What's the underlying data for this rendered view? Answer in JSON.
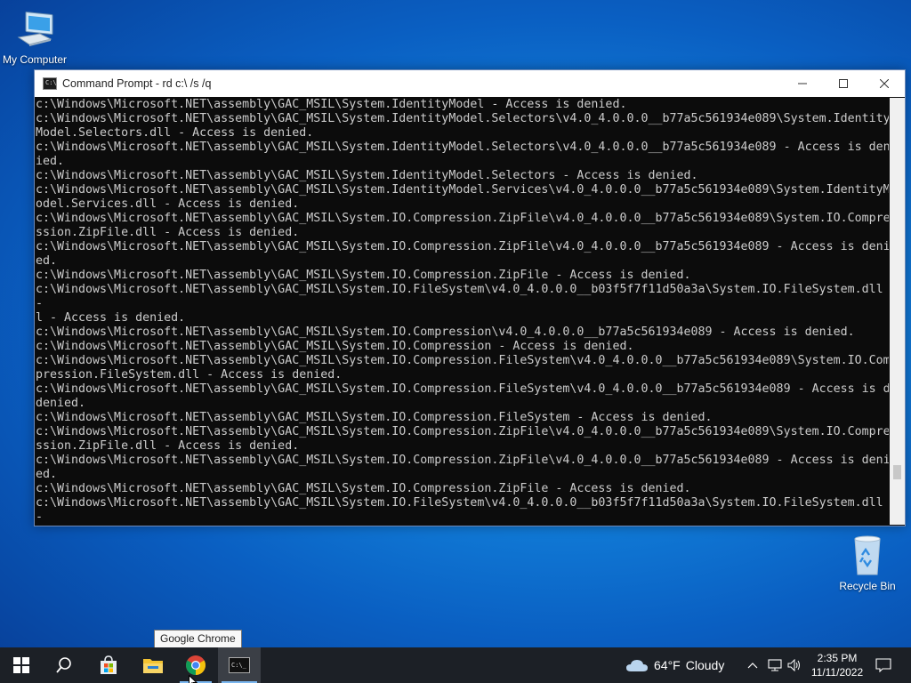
{
  "desktop": {
    "icons": [
      {
        "label": "My Computer"
      },
      {
        "label": "Recycle Bin"
      }
    ]
  },
  "window": {
    "title": "Command Prompt - rd  c:\\ /s /q",
    "console_lines": [
      "c:\\Windows\\Microsoft.NET\\assembly\\GAC_MSIL\\System.IdentityModel - Access is denied.",
      "c:\\Windows\\Microsoft.NET\\assembly\\GAC_MSIL\\System.IdentityModel.Selectors\\v4.0_4.0.0.0__b77a5c561934e089\\System.Identity",
      "Model.Selectors.dll - Access is denied.",
      "c:\\Windows\\Microsoft.NET\\assembly\\GAC_MSIL\\System.IdentityModel.Selectors\\v4.0_4.0.0.0__b77a5c561934e089 - Access is deni",
      "ied.",
      "c:\\Windows\\Microsoft.NET\\assembly\\GAC_MSIL\\System.IdentityModel.Selectors - Access is denied.",
      "c:\\Windows\\Microsoft.NET\\assembly\\GAC_MSIL\\System.IdentityModel.Services\\v4.0_4.0.0.0__b77a5c561934e089\\System.IdentityM",
      "odel.Services.dll - Access is denied.",
      "c:\\Windows\\Microsoft.NET\\assembly\\GAC_MSIL\\System.IO.Compression.ZipFile\\v4.0_4.0.0.0__b77a5c561934e089\\System.IO.Compre",
      "ssion.ZipFile.dll - Access is denied.",
      "c:\\Windows\\Microsoft.NET\\assembly\\GAC_MSIL\\System.IO.Compression.ZipFile\\v4.0_4.0.0.0__b77a5c561934e089 - Access is deni",
      "ed.",
      "c:\\Windows\\Microsoft.NET\\assembly\\GAC_MSIL\\System.IO.Compression.ZipFile - Access is denied.",
      "c:\\Windows\\Microsoft.NET\\assembly\\GAC_MSIL\\System.IO.FileSystem\\v4.0_4.0.0.0__b03f5f7f11d50a3a\\System.IO.FileSystem.dll",
      "-",
      "l - Access is denied.",
      "c:\\Windows\\Microsoft.NET\\assembly\\GAC_MSIL\\System.IO.Compression\\v4.0_4.0.0.0__b77a5c561934e089 - Access is denied.",
      "c:\\Windows\\Microsoft.NET\\assembly\\GAC_MSIL\\System.IO.Compression - Access is denied.",
      "c:\\Windows\\Microsoft.NET\\assembly\\GAC_MSIL\\System.IO.Compression.FileSystem\\v4.0_4.0.0.0__b77a5c561934e089\\System.IO.Com",
      "pression.FileSystem.dll - Access is denied.",
      "c:\\Windows\\Microsoft.NET\\assembly\\GAC_MSIL\\System.IO.Compression.FileSystem\\v4.0_4.0.0.0__b77a5c561934e089 - Access is d",
      "denied.",
      "c:\\Windows\\Microsoft.NET\\assembly\\GAC_MSIL\\System.IO.Compression.FileSystem - Access is denied.",
      "c:\\Windows\\Microsoft.NET\\assembly\\GAC_MSIL\\System.IO.Compression.ZipFile\\v4.0_4.0.0.0__b77a5c561934e089\\System.IO.Compre",
      "ssion.ZipFile.dll - Access is denied.",
      "c:\\Windows\\Microsoft.NET\\assembly\\GAC_MSIL\\System.IO.Compression.ZipFile\\v4.0_4.0.0.0__b77a5c561934e089 - Access is deni",
      "ed.",
      "c:\\Windows\\Microsoft.NET\\assembly\\GAC_MSIL\\System.IO.Compression.ZipFile - Access is denied.",
      "c:\\Windows\\Microsoft.NET\\assembly\\GAC_MSIL\\System.IO.FileSystem\\v4.0_4.0.0.0__b03f5f7f11d50a3a\\System.IO.FileSystem.dll",
      "-"
    ]
  },
  "tooltip": {
    "text": "Google Chrome"
  },
  "taskbar": {
    "weather": {
      "temp": "64°F",
      "condition": "Cloudy"
    },
    "clock": {
      "time": "2:35 PM",
      "date": "11/11/2022"
    }
  },
  "colors": {
    "console_bg": "#0c0c0c",
    "console_text": "#cccccc",
    "taskbar_bg": "#1c2026",
    "accent": "#7ab6ef"
  }
}
